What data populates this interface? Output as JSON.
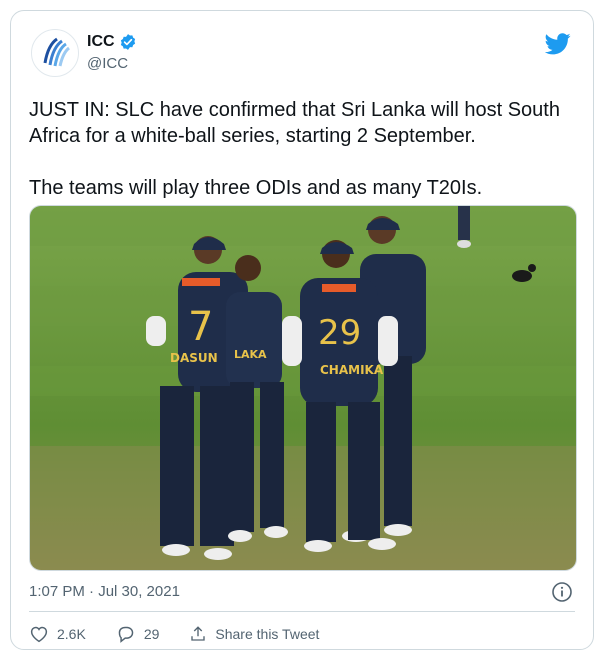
{
  "account": {
    "name": "ICC",
    "handle": "@ICC",
    "avatar_icon": "icc-logo",
    "verified_icon": "verified-badge-icon",
    "brand_icon": "twitter-bird-icon"
  },
  "tweet": {
    "paragraph1": "JUST IN: SLC have confirmed that Sri Lanka will host South Africa for a white-ball series, starting 2 September.",
    "paragraph2": "The teams will play three ODIs and as many T20Is."
  },
  "photo": {
    "jersey_names": [
      "DASUN",
      "LAKA",
      "CHAMIKA"
    ],
    "jersey_numbers": [
      "7",
      "29"
    ]
  },
  "meta": {
    "timestamp": "1:07 PM · Jul 30, 2021"
  },
  "actions": {
    "likes": "2.6K",
    "replies": "29",
    "share_label": "Share this Tweet"
  },
  "colors": {
    "twitter_blue": "#1d9bf0",
    "text": "#0f1419",
    "secondary": "#536471",
    "field_green": "#6f9a3e",
    "jersey_navy": "#1f2d4a"
  }
}
